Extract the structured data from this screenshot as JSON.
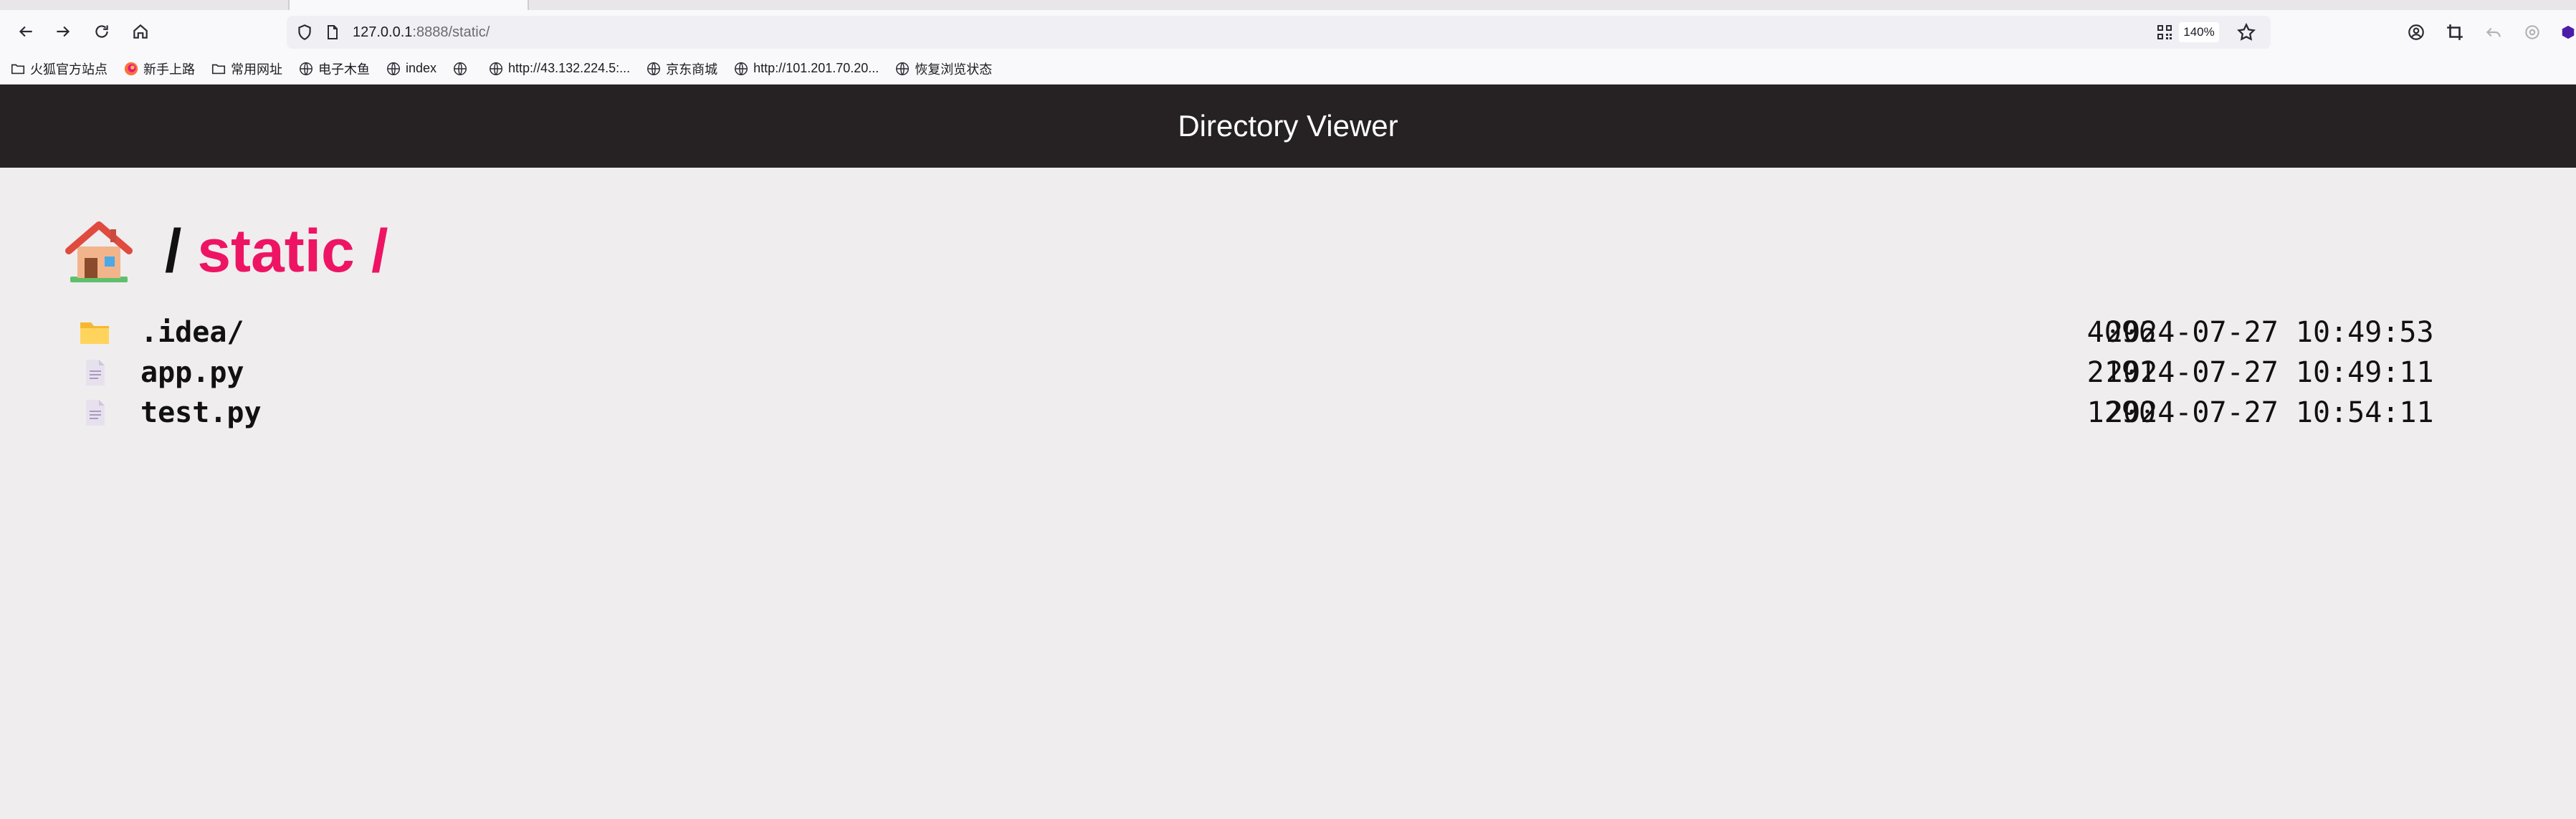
{
  "browser": {
    "url_host": "127.0.0.1",
    "url_path": ":8888/static/",
    "zoom": "140%",
    "bookmarks": [
      {
        "label": "火狐官方站点",
        "icon": "folder-icon"
      },
      {
        "label": "新手上路",
        "icon": "firefox-icon"
      },
      {
        "label": "常用网址",
        "icon": "folder-icon"
      },
      {
        "label": "电子木鱼",
        "icon": "globe-icon"
      },
      {
        "label": "index",
        "icon": "globe-icon"
      },
      {
        "label": "",
        "icon": "globe-icon"
      },
      {
        "label": "http://43.132.224.5:...",
        "icon": "globe-icon"
      },
      {
        "label": "京东商城",
        "icon": "globe-icon"
      },
      {
        "label": "http://101.201.70.20...",
        "icon": "globe-icon"
      },
      {
        "label": "恢复浏览状态",
        "icon": "globe-icon"
      }
    ]
  },
  "page": {
    "header_title": "Directory Viewer",
    "breadcrumb_separator": "/",
    "breadcrumb_dir": "static /"
  },
  "files": [
    {
      "name": ".idea/",
      "size": "4096",
      "modified": "2024-07-27 10:49:53",
      "type": "folder-icon"
    },
    {
      "name": "app.py",
      "size": "2191",
      "modified": "2024-07-27 10:49:11",
      "type": "file-icon"
    },
    {
      "name": "test.py",
      "size": "1290",
      "modified": "2024-07-27 10:54:11",
      "type": "file-icon"
    }
  ],
  "colors": {
    "header_bg": "#262223",
    "page_bg": "#efedee",
    "accent": "#ee1464"
  }
}
